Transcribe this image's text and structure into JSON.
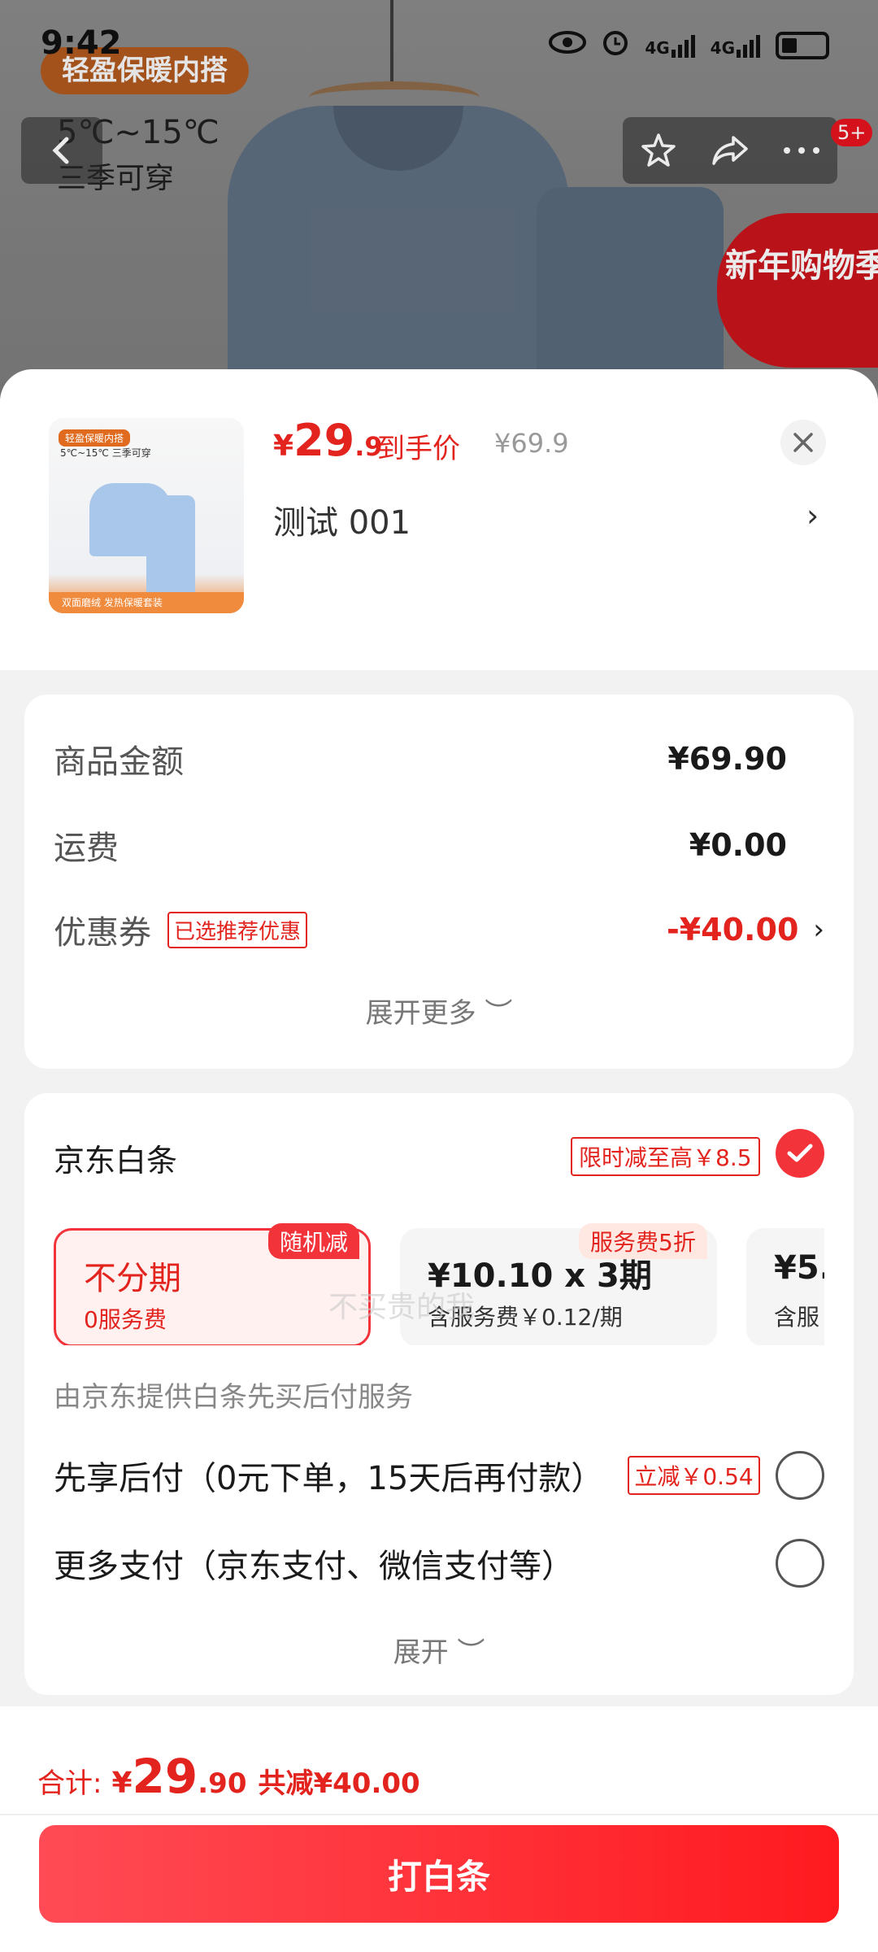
{
  "status_bar": {
    "time": "9:42",
    "net1": "4G",
    "net2": "4G"
  },
  "hero": {
    "tag": "轻盈保暖内搭",
    "temp_range": "5℃~15℃",
    "season": "三季可穿",
    "promo": "新年购物季",
    "notification_count": "5+"
  },
  "sheet": {
    "price_currency": "¥",
    "price_int": "29",
    "price_dec": ".9",
    "price_label": "到手价",
    "original_price": "¥69.9",
    "sku_name": "测试  001",
    "thumb_tag": "轻盈保暖内搭",
    "thumb_temp": "5℃~15℃ 三季可穿",
    "thumb_footer": "双面磨绒 发热保暖套装"
  },
  "amount_card": {
    "goods_label": "商品金额",
    "goods_value": "¥69.90",
    "shipping_label": "运费",
    "shipping_value": "¥0.00",
    "coupon_label": "优惠券",
    "coupon_tag": "已选推荐优惠",
    "coupon_value": "-¥40.00",
    "expand_label": "展开更多 ︶"
  },
  "watermark": "不买贵的我",
  "pay_card": {
    "title": "京东白条",
    "limit_tag": "限时减至高￥8.5",
    "plans": [
      {
        "title": "不分期",
        "sub": "0服务费",
        "badge": "随机减"
      },
      {
        "title": "¥10.10 x 3期",
        "sub": "含服务费￥0.12/期",
        "badge": "服务费5折"
      },
      {
        "title": "¥5.",
        "sub": "含服"
      }
    ],
    "provider": "由京东提供白条先买后付服务",
    "option1": "先享后付（0元下单，15天后再付款）",
    "option1_tag": "立减￥0.54",
    "option2": "更多支付（京东支付、微信支付等）",
    "expand_label": "展开 ︶"
  },
  "bottom": {
    "total_label": "合计:",
    "total_currency": "¥",
    "total_int": "29",
    "total_dec": ".90",
    "saving": "共减¥40.00",
    "button_label": "打白条"
  },
  "colors": {
    "accent": "#e3231d",
    "button": "#ff1a1f"
  }
}
